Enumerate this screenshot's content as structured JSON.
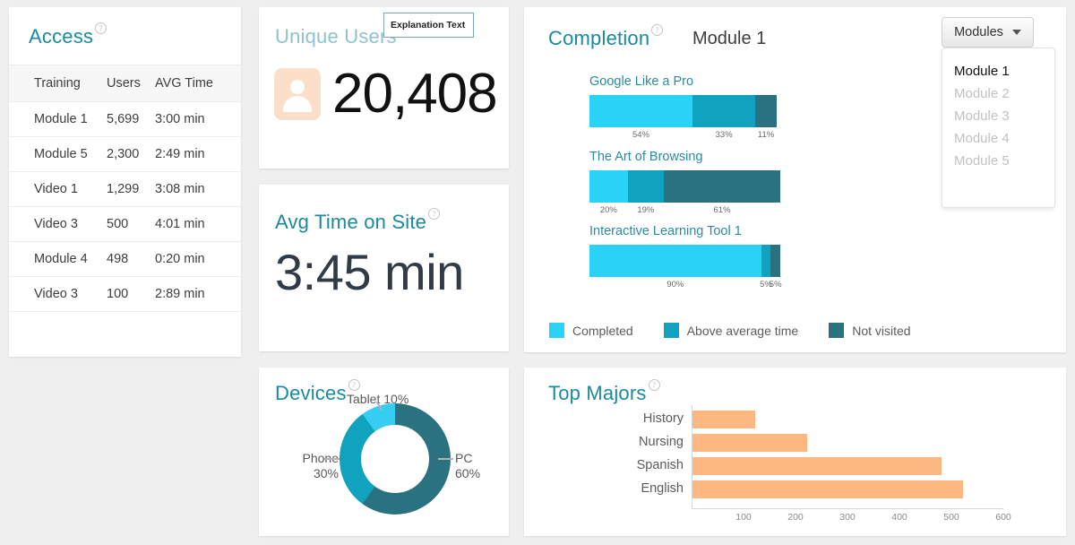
{
  "theme": {
    "page_background": "#efefef",
    "card_background": "#ffffff",
    "title_teal": "#1a8a9e",
    "title_teal_light": "#8ec3cf",
    "completed_cyan": "#2ad2f5",
    "above_avg_teal": "#11a2bf",
    "not_visited_dark": "#2b7280",
    "orange_bar": "#fdab6b",
    "avatar_peach": "#fbdfc9"
  },
  "access": {
    "title": "Access",
    "help_icon": "help-circle-icon",
    "columns": [
      "Training",
      "Users",
      "AVG Time"
    ],
    "rows": [
      {
        "training": "Module 1",
        "users": "5,699",
        "avg_time": "3:00 min"
      },
      {
        "training": "Module 5",
        "users": "2,300",
        "avg_time": "2:49 min"
      },
      {
        "training": "Video 1",
        "users": "1,299",
        "avg_time": "3:08 min"
      },
      {
        "training": "Video 3",
        "users": "500",
        "avg_time": "4:01 min"
      },
      {
        "training": "Module 4",
        "users": "498",
        "avg_time": "0:20 min"
      },
      {
        "training": "Video 3",
        "users": "100",
        "avg_time": "2:89 min"
      }
    ]
  },
  "unique_users": {
    "title": "Unique Users",
    "value": "20,408",
    "icon": "user-avatar-icon",
    "explanation_text": "Explanation Text"
  },
  "avg_time_on_site": {
    "title": "Avg Time on Site",
    "help_icon": "help-circle-icon",
    "value": "3:45 min"
  },
  "completion": {
    "title": "Completion",
    "help_icon": "help-circle-icon",
    "subtitle": "Module 1",
    "dropdown": {
      "label": "Modules",
      "caret_icon": "chevron-down-icon",
      "open": true,
      "options": [
        "Module 1",
        "Module 2",
        "Module 3",
        "Module 4",
        "Module 5"
      ],
      "selected": "Module 1"
    },
    "legend": [
      {
        "label": "Completed",
        "color": "#2ad2f5"
      },
      {
        "label": "Above average time",
        "color": "#11a2bf"
      },
      {
        "label": "Not visited",
        "color": "#2b7280"
      }
    ]
  },
  "chart_data": [
    {
      "type": "bar",
      "title": "Completion",
      "subtitle": "Module 1",
      "orientation": "horizontal-stacked",
      "stacked": true,
      "unit": "percent",
      "categories": [
        "Google Like a Pro",
        "The Art of Browsing",
        "Interactive Learning Tool 1"
      ],
      "series": [
        {
          "name": "Completed",
          "color": "#2ad2f5",
          "values": [
            54,
            20,
            90
          ]
        },
        {
          "name": "Above average time",
          "color": "#11a2bf",
          "values": [
            33,
            19,
            5
          ]
        },
        {
          "name": "Not visited",
          "color": "#2b7280",
          "values": [
            11,
            61,
            5
          ]
        }
      ],
      "data_labels": [
        [
          "54%",
          "33%",
          "11%"
        ],
        [
          "20%",
          "19%",
          "61%"
        ],
        [
          "90%",
          "5%",
          "5%"
        ]
      ],
      "xlabel": "",
      "ylabel": "",
      "grid": false,
      "legend_position": "bottom"
    },
    {
      "type": "pie",
      "title": "Devices",
      "donut": true,
      "labels": [
        "PC",
        "Phone",
        "Tablet"
      ],
      "values": [
        60,
        30,
        10
      ],
      "value_labels": [
        "PC 60%",
        "Phone 30%",
        "Tablet 10%"
      ],
      "colors": [
        "#2b7280",
        "#11a2bf",
        "#35cdf0"
      ],
      "unit": "percent",
      "legend_position": "callout-labels"
    },
    {
      "type": "bar",
      "title": "Top Majors",
      "orientation": "horizontal",
      "categories": [
        "History",
        "Nursing",
        "Spanish",
        "English"
      ],
      "values": [
        120,
        220,
        480,
        520
      ],
      "color": "#fdab6b",
      "xlabel": "",
      "ylabel": "",
      "xlim": [
        0,
        600
      ],
      "xticks": [
        100,
        200,
        300,
        400,
        500,
        600
      ],
      "grid": false,
      "legend_position": "none"
    }
  ],
  "devices": {
    "title": "Devices",
    "help_icon": "help-circle-icon",
    "labels": {
      "tablet": "Tablet 10%",
      "phone_name": "Phone",
      "phone_pct": "30%",
      "pc_name": "PC",
      "pc_pct": "60%"
    }
  },
  "top_majors": {
    "title": "Top Majors",
    "help_icon": "help-circle-icon"
  }
}
